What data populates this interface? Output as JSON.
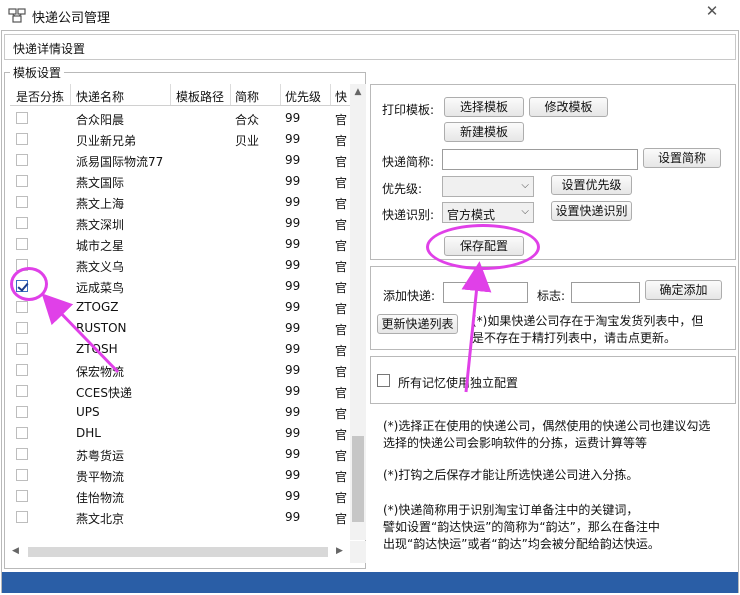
{
  "window": {
    "title": "快递公司管理",
    "close_label": "✕"
  },
  "section_header": "快递详情设置",
  "template_group": {
    "title": "模板设置",
    "columns": [
      "是否分拣",
      "快递名称",
      "模板路径",
      "简称",
      "优先级",
      "快"
    ],
    "rows": [
      {
        "checked": false,
        "name": "合众阳晨",
        "path": "",
        "abbr": "合众",
        "priority": "99",
        "cut": "官"
      },
      {
        "checked": false,
        "name": "贝业新兄弟",
        "path": "",
        "abbr": "贝业",
        "priority": "99",
        "cut": "官"
      },
      {
        "checked": false,
        "name": "派易国际物流77",
        "path": "",
        "abbr": "",
        "priority": "99",
        "cut": "官"
      },
      {
        "checked": false,
        "name": "燕文国际",
        "path": "",
        "abbr": "",
        "priority": "99",
        "cut": "官"
      },
      {
        "checked": false,
        "name": "燕文上海",
        "path": "",
        "abbr": "",
        "priority": "99",
        "cut": "官"
      },
      {
        "checked": false,
        "name": "燕文深圳",
        "path": "",
        "abbr": "",
        "priority": "99",
        "cut": "官"
      },
      {
        "checked": false,
        "name": "城市之星",
        "path": "",
        "abbr": "",
        "priority": "99",
        "cut": "官"
      },
      {
        "checked": false,
        "name": "燕文义乌",
        "path": "",
        "abbr": "",
        "priority": "99",
        "cut": "官"
      },
      {
        "checked": true,
        "name": "远成菜鸟",
        "path": "",
        "abbr": "",
        "priority": "99",
        "cut": "官"
      },
      {
        "checked": false,
        "name": "ZTOGZ",
        "path": "",
        "abbr": "",
        "priority": "99",
        "cut": "官"
      },
      {
        "checked": false,
        "name": "RUSTON",
        "path": "",
        "abbr": "",
        "priority": "99",
        "cut": "官"
      },
      {
        "checked": false,
        "name": "ZTOSH",
        "path": "",
        "abbr": "",
        "priority": "99",
        "cut": "官"
      },
      {
        "checked": false,
        "name": "保宏物流",
        "path": "",
        "abbr": "",
        "priority": "99",
        "cut": "官"
      },
      {
        "checked": false,
        "name": "CCES快递",
        "path": "",
        "abbr": "",
        "priority": "99",
        "cut": "官"
      },
      {
        "checked": false,
        "name": "UPS",
        "path": "",
        "abbr": "",
        "priority": "99",
        "cut": "官"
      },
      {
        "checked": false,
        "name": "DHL",
        "path": "",
        "abbr": "",
        "priority": "99",
        "cut": "官"
      },
      {
        "checked": false,
        "name": "苏粤货运",
        "path": "",
        "abbr": "",
        "priority": "99",
        "cut": "官"
      },
      {
        "checked": false,
        "name": "贵平物流",
        "path": "",
        "abbr": "",
        "priority": "99",
        "cut": "官"
      },
      {
        "checked": false,
        "name": "佳怡物流",
        "path": "",
        "abbr": "",
        "priority": "99",
        "cut": "官"
      },
      {
        "checked": false,
        "name": "燕文北京",
        "path": "",
        "abbr": "",
        "priority": "99",
        "cut": "官"
      }
    ]
  },
  "print_panel": {
    "print_template_label": "打印模板:",
    "select_template_btn": "选择模板",
    "modify_template_btn": "修改模板",
    "new_template_btn": "新建模板",
    "abbr_label": "快递简称:",
    "abbr_value": "",
    "set_abbr_btn": "设置简称",
    "priority_label": "优先级:",
    "priority_value": "",
    "set_priority_btn": "设置优先级",
    "recognize_label": "快递识别:",
    "recognize_value": "官方模式",
    "set_recognize_btn": "设置快递识别",
    "save_config_btn": "保存配置"
  },
  "add_panel": {
    "add_label": "添加快递:",
    "add_value": "",
    "flag_label": "标志:",
    "flag_value": "",
    "confirm_add_btn": "确定添加",
    "update_list_btn": "更新快递列表",
    "note_line1": "(*)如果快递公司存在于淘宝发货列表中，但",
    "note_line2": "是不存在于精打列表中，请击点更新。"
  },
  "independent_config": {
    "label": "所有记忆使用独立配置",
    "checked": false
  },
  "notes": {
    "n1_line1": "(*)选择正在使用的快递公司，偶然使用的快递公司也建议勾选",
    "n1_line2": "选择的快递公司会影响软件的分拣，运费计算等等",
    "n2": "(*)打钩之后保存才能让所选快递公司进入分拣。",
    "n3_line1": "(*)快递简称用于识别淘宝订单备注中的关键词，",
    "n3_line2": "譬如设置“韵达快运”的简称为“韵达”，那么在备注中",
    "n3_line3": "出现“韵达快运”或者“韵达”均会被分配给韵达快运。"
  },
  "colors": {
    "annotation": "#e040e8",
    "statusbar": "#2a5ea6",
    "grid_text": "#111111"
  },
  "icons": {
    "app": "app-icon",
    "close": "close-icon",
    "dropdown": "chevron-down-icon"
  }
}
